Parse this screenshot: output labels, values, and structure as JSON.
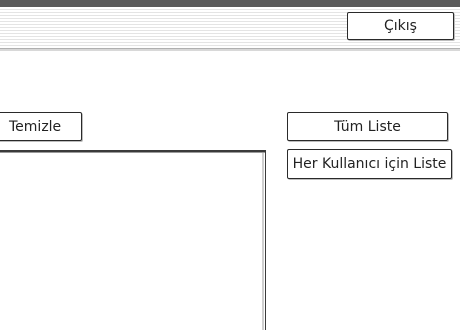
{
  "header": {
    "exit_label": "Çıkış"
  },
  "actions": {
    "clear_label": "Temizle",
    "all_list_label": "Tüm Liste",
    "per_user_list_label": "Her Kullanıcı için Liste"
  },
  "list": {
    "items": []
  }
}
